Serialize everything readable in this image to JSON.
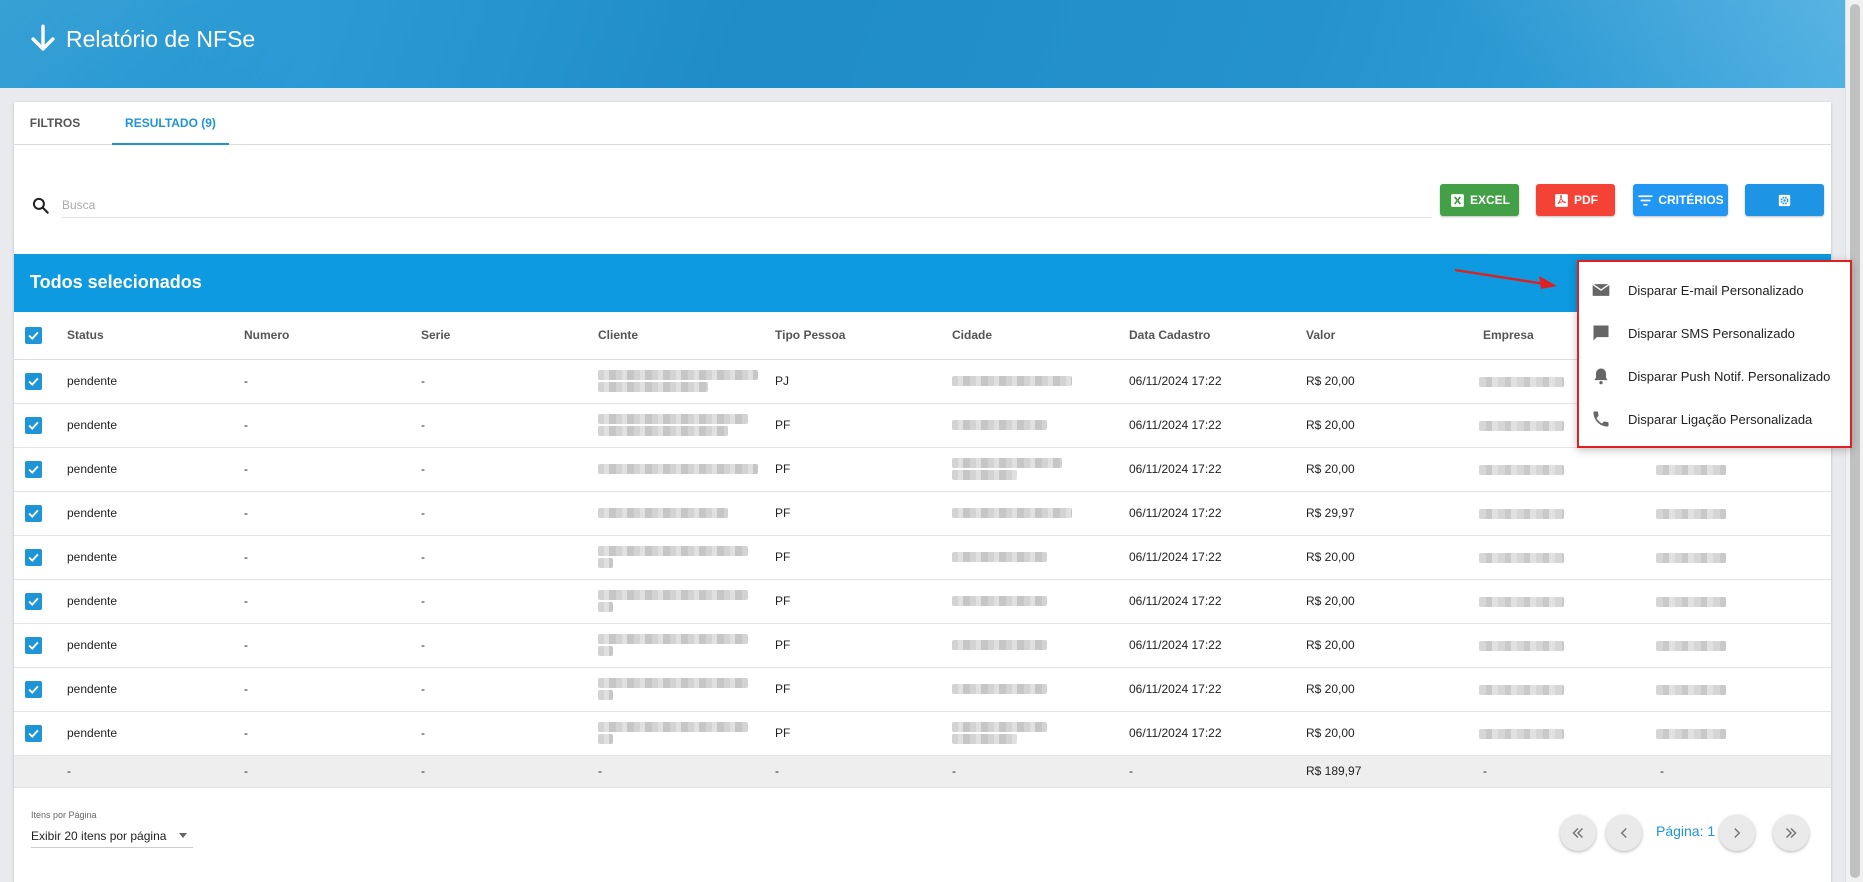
{
  "header": {
    "title": "Relatório de NFSe",
    "back_icon": "arrow-down-icon"
  },
  "tabs": [
    {
      "label": "FILTROS",
      "active": false
    },
    {
      "label": "RESULTADO (9)",
      "active": true
    }
  ],
  "search": {
    "placeholder": "Busca",
    "value": "",
    "icon": "search-icon"
  },
  "toolbar": {
    "excel_label": "EXCEL",
    "pdf_label": "PDF",
    "criterios_label": "CRITÉRIOS",
    "settings_icon": "gear-icon"
  },
  "selection_bar": {
    "text": "Todos selecionados"
  },
  "table": {
    "columns": [
      "Status",
      "Numero",
      "Serie",
      "Cliente",
      "Tipo Pessoa",
      "Cidade",
      "Data Cadastro",
      "Valor",
      "Empresa"
    ],
    "rows": [
      {
        "status": "pendente",
        "numero": "-",
        "serie": "-",
        "tipo": "PJ",
        "data": "06/11/2024 17:22",
        "valor": "R$ 20,00"
      },
      {
        "status": "pendente",
        "numero": "-",
        "serie": "-",
        "tipo": "PF",
        "data": "06/11/2024 17:22",
        "valor": "R$ 20,00"
      },
      {
        "status": "pendente",
        "numero": "-",
        "serie": "-",
        "tipo": "PF",
        "data": "06/11/2024 17:22",
        "valor": "R$ 20,00"
      },
      {
        "status": "pendente",
        "numero": "-",
        "serie": "-",
        "tipo": "PF",
        "data": "06/11/2024 17:22",
        "valor": "R$ 29,97"
      },
      {
        "status": "pendente",
        "numero": "-",
        "serie": "-",
        "tipo": "PF",
        "data": "06/11/2024 17:22",
        "valor": "R$ 20,00"
      },
      {
        "status": "pendente",
        "numero": "-",
        "serie": "-",
        "tipo": "PF",
        "data": "06/11/2024 17:22",
        "valor": "R$ 20,00"
      },
      {
        "status": "pendente",
        "numero": "-",
        "serie": "-",
        "tipo": "PF",
        "data": "06/11/2024 17:22",
        "valor": "R$ 20,00"
      },
      {
        "status": "pendente",
        "numero": "-",
        "serie": "-",
        "tipo": "PF",
        "data": "06/11/2024 17:22",
        "valor": "R$ 20,00"
      },
      {
        "status": "pendente",
        "numero": "-",
        "serie": "-",
        "tipo": "PF",
        "data": "06/11/2024 17:22",
        "valor": "R$ 20,00"
      }
    ],
    "totals": [
      "-",
      "-",
      "-",
      "-",
      "-",
      "-",
      "-",
      "R$ 189,97",
      "-",
      "-"
    ]
  },
  "pagination": {
    "items_label": "Itens por Página",
    "items_value": "Exibir 20 itens por página",
    "page_label": "Página: 1"
  },
  "context_menu": {
    "items": [
      {
        "label": "Disparar E-mail Personalizado",
        "icon": "email-icon"
      },
      {
        "label": "Disparar SMS Personalizado",
        "icon": "sms-icon"
      },
      {
        "label": "Disparar Push Notif. Personalizado",
        "icon": "bell-icon"
      },
      {
        "label": "Disparar Ligação Personalizada",
        "icon": "phone-icon"
      }
    ]
  },
  "colors": {
    "accent": "#1e95d6",
    "selection_bar": "#0d9ae0",
    "excel": "#43a047",
    "pdf": "#f44336",
    "criterios": "#2196f3",
    "settings": "#1e95e4",
    "highlight": "#e02020"
  }
}
